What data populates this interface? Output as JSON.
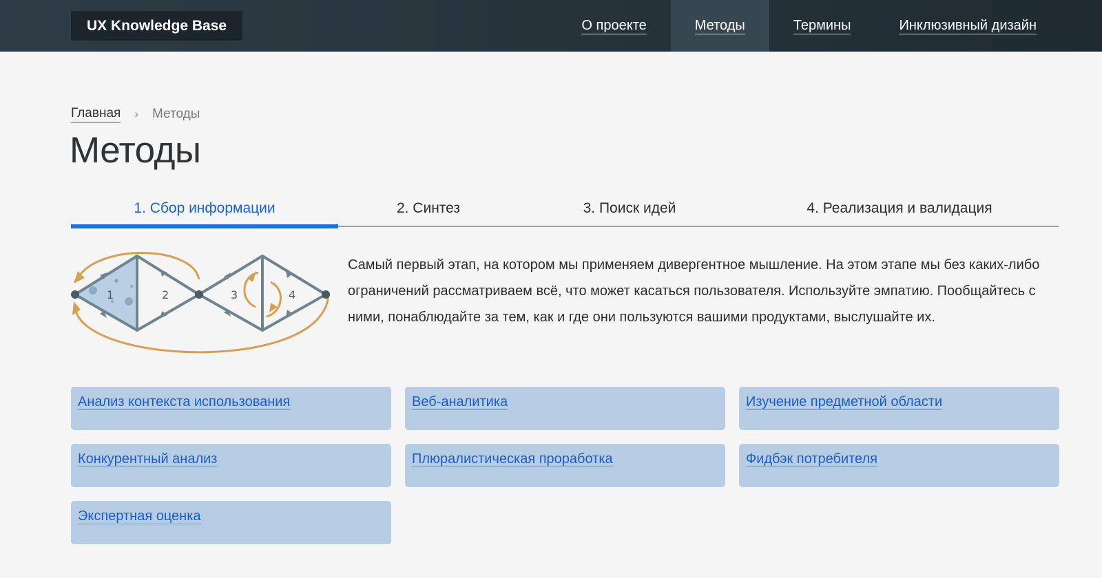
{
  "header": {
    "logo": "UX Knowledge Base",
    "nav": [
      {
        "label": "О проекте",
        "active": false
      },
      {
        "label": "Методы",
        "active": true
      },
      {
        "label": "Термины",
        "active": false
      },
      {
        "label": "Инклюзивный дизайн",
        "active": false
      }
    ]
  },
  "breadcrumb": {
    "home": "Главная",
    "separator_icon": "chevron-right-icon",
    "current": "Методы"
  },
  "page": {
    "title": "Методы",
    "tabs": [
      {
        "label": "1. Сбор информации",
        "active": true
      },
      {
        "label": "2. Синтез",
        "active": false
      },
      {
        "label": "3. Поиск идей",
        "active": false
      },
      {
        "label": "4. Реализация и валидация",
        "active": false
      }
    ],
    "diagram": {
      "labels": [
        "1",
        "2",
        "3",
        "4"
      ]
    },
    "description": "Самый первый этап, на котором мы применяем дивергентное мышление. На этом этапе мы без каких-либо ограничений рассматриваем всё, что может касаться пользователя. Используйте эмпатию. Пообщайтесь с ними, понаблюдайте за тем, как и где они пользуются вашими продуктами, выслушайте их.",
    "methods": [
      "Анализ контекста использования",
      "Веб-аналитика",
      "Изучение предметной области",
      "Конкурентный анализ",
      "Плюралистическая проработка",
      "Фидбэк потребителя",
      "Экспертная оценка"
    ]
  },
  "colors": {
    "header_bg": "#26323a",
    "nav_active_bg": "#37474f",
    "accent": "#1a73e8",
    "card_bg": "#b7cde4",
    "diagram_orange": "#d6a050",
    "diagram_gray": "#6e8590"
  }
}
